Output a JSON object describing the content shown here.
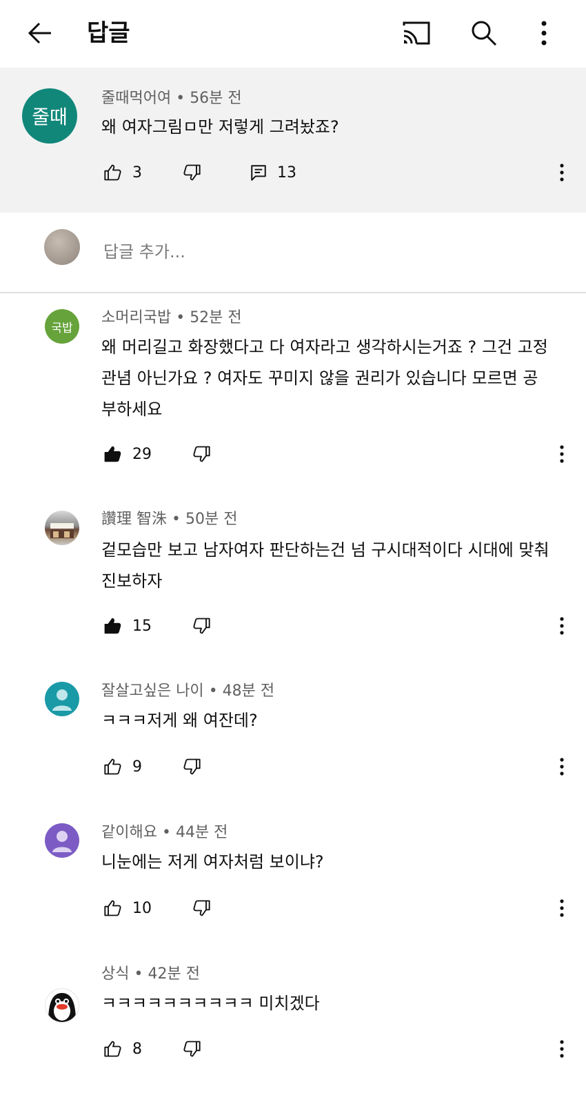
{
  "header": {
    "title": "답글"
  },
  "parent": {
    "avatar_text": "줄때",
    "author": "줄때먹어여",
    "time": "56분 전",
    "text": "왜 여자그림ㅁ만 저렇게 그려놨죠?",
    "likes": "3",
    "replies": "13"
  },
  "add_reply": {
    "placeholder": "답글 추가..."
  },
  "comments": [
    {
      "avatar_text": "국밥",
      "author": "소머리국밥",
      "time": "52분 전",
      "text": "왜 머리길고 화장했다고 다 여자라고 생각하시는거죠 ? 그건 고정관념 아닌가요 ? 여자도 꾸미지 않을 권리가 있습니다 모르면 공부하세요",
      "likes": "29"
    },
    {
      "author": "讚理 智洙",
      "time": "50분 전",
      "text": "겉모습만 보고 남자여자 판단하는건 넘 구시대적이다 시대에 맞춰 진보하자",
      "likes": "15"
    },
    {
      "author": "잘살고싶은 나이",
      "time": "48분 전",
      "text": "ㅋㅋㅋ저게 왜 여잔데?",
      "likes": "9"
    },
    {
      "author": "같이해요",
      "time": "44분 전",
      "text": "니눈에는 저게 여자처럼 보이냐?",
      "likes": "10"
    },
    {
      "author": "상식",
      "time": "42분 전",
      "text": "ㅋㅋㅋㅋㅋㅋㅋㅋㅋㅋ 미치겠다",
      "likes": "8"
    }
  ],
  "colors": {
    "avatar_parent": "#11877a",
    "avatar_gukbap": "#66a33b",
    "avatar_teal": "#1a9aa6",
    "avatar_purple": "#7c5cc4"
  }
}
